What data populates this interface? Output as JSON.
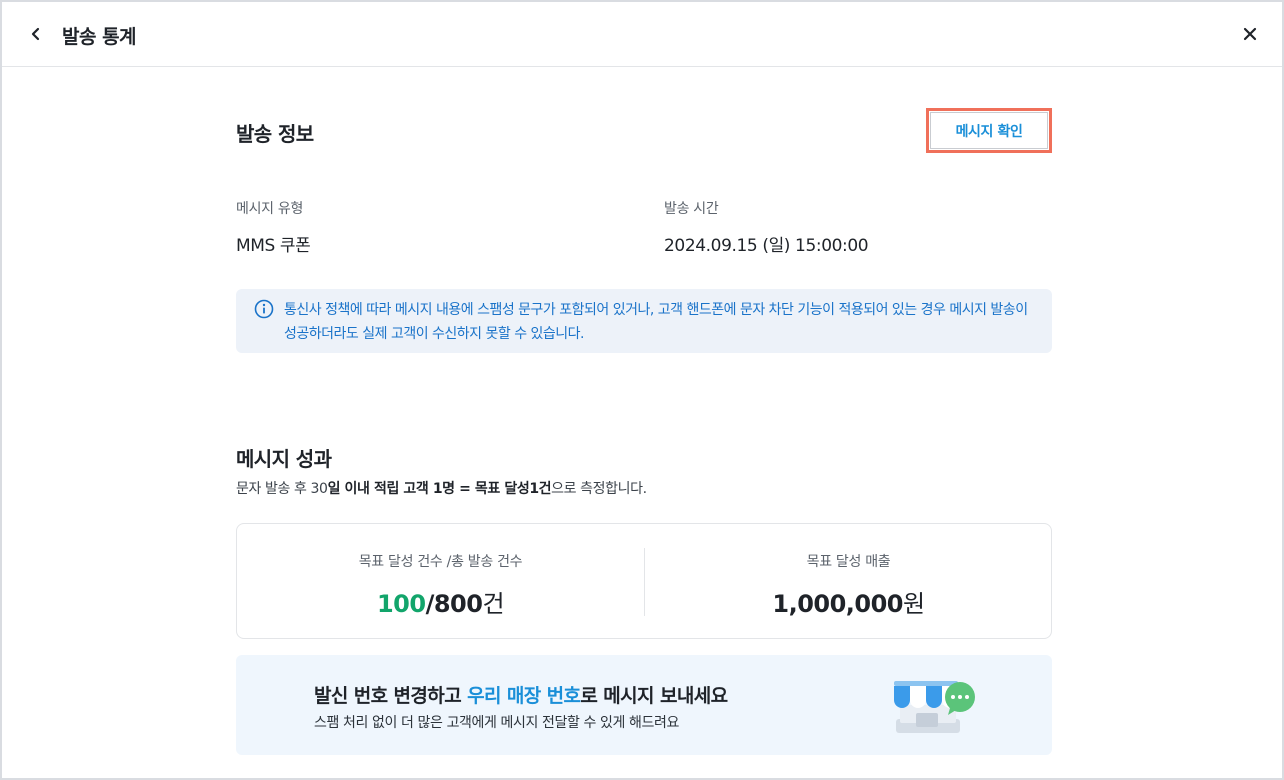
{
  "header": {
    "title": "발송 통계",
    "back_icon": "chevron-left-icon",
    "close_icon": "close-icon"
  },
  "send_info": {
    "title": "발송 정보",
    "confirm_button": "메시지 확인",
    "message_type_label": "메시지 유형",
    "message_type_value": "MMS 쿠폰",
    "send_time_label": "발송 시간",
    "send_time_value": "2024.09.15 (일) 15:00:00"
  },
  "notice": {
    "icon": "info-icon",
    "text": "통신사 정책에 따라 메시지 내용에 스팸성 문구가 포함되어 있거나, 고객 핸드폰에 문자 차단 기능이 적용되어 있는 경우 메시지 발송이 성공하더라도 실제 고객이 수신하지 못할 수 있습니다."
  },
  "performance": {
    "title": "메시지 성과",
    "desc_prefix": "문자 발송 후 30",
    "desc_bold": "일 이내 적립 고객 1명 = 목표 달성1건",
    "desc_suffix": "으로 측정합니다.",
    "goal_count_label": "목표 달성 건수 /총 발송 건수",
    "goal_count_value": "100",
    "total_count_value": "/800",
    "count_unit": "건",
    "revenue_label": "목표 달성 매출",
    "revenue_value": "1,000,000",
    "revenue_unit": "원"
  },
  "banner": {
    "title_prefix": "발신 번호 변경하고 ",
    "title_highlight": "우리 매장 번호",
    "title_suffix": "로 메시지 보내세요",
    "desc": "스팸 처리 없이 더 많은 고객에게 메시지 전달할 수 있게 해드려요",
    "art_icon": "store-chat-icon"
  },
  "colors": {
    "accent_blue": "#1a8fd8",
    "highlight_green": "#12a56b",
    "notice_bg": "#edf2f9",
    "banner_bg": "#eff6fd",
    "focus_outline": "#f0705a"
  }
}
